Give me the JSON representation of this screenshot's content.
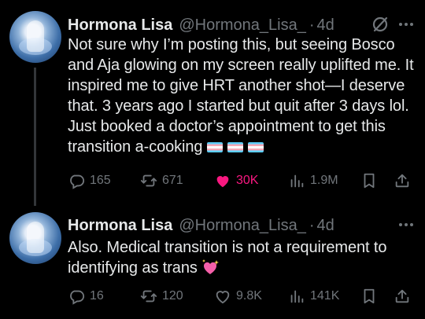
{
  "tweets": [
    {
      "author_name": "Hormona Lisa",
      "handle": "@Hormona_Lisa_",
      "separator": "·",
      "time": "4d",
      "text": "Not sure why I’m posting this, but seeing Bosco and Aja glowing on my screen really uplifted me. It inspired me to give HRT another shot—I deserve that. 3 years ago I started but quit after 3 days lol. Just booked a doctor’s appointment to get this transition a-cooking",
      "emoji": [
        "transgender-flag",
        "transgender-flag",
        "transgender-flag"
      ],
      "replies": "165",
      "reposts": "671",
      "likes": "30K",
      "liked": true,
      "views": "1.9M"
    },
    {
      "author_name": "Hormona Lisa",
      "handle": "@Hormona_Lisa_",
      "separator": "·",
      "time": "4d",
      "text": "Also. Medical transition is not a requirement to identifying as trans",
      "emoji": [
        "sparkling-heart"
      ],
      "replies": "16",
      "reposts": "120",
      "likes": "9.8K",
      "liked": false,
      "views": "141K"
    }
  ],
  "colors": {
    "background": "#000000",
    "text": "#e7e9ea",
    "muted": "#71767b",
    "like_active": "#f91880",
    "thread_line": "#333639"
  },
  "icons": [
    "grok-icon",
    "more-icon",
    "reply-icon",
    "repost-icon",
    "like-icon",
    "views-icon",
    "bookmark-icon",
    "share-icon"
  ]
}
